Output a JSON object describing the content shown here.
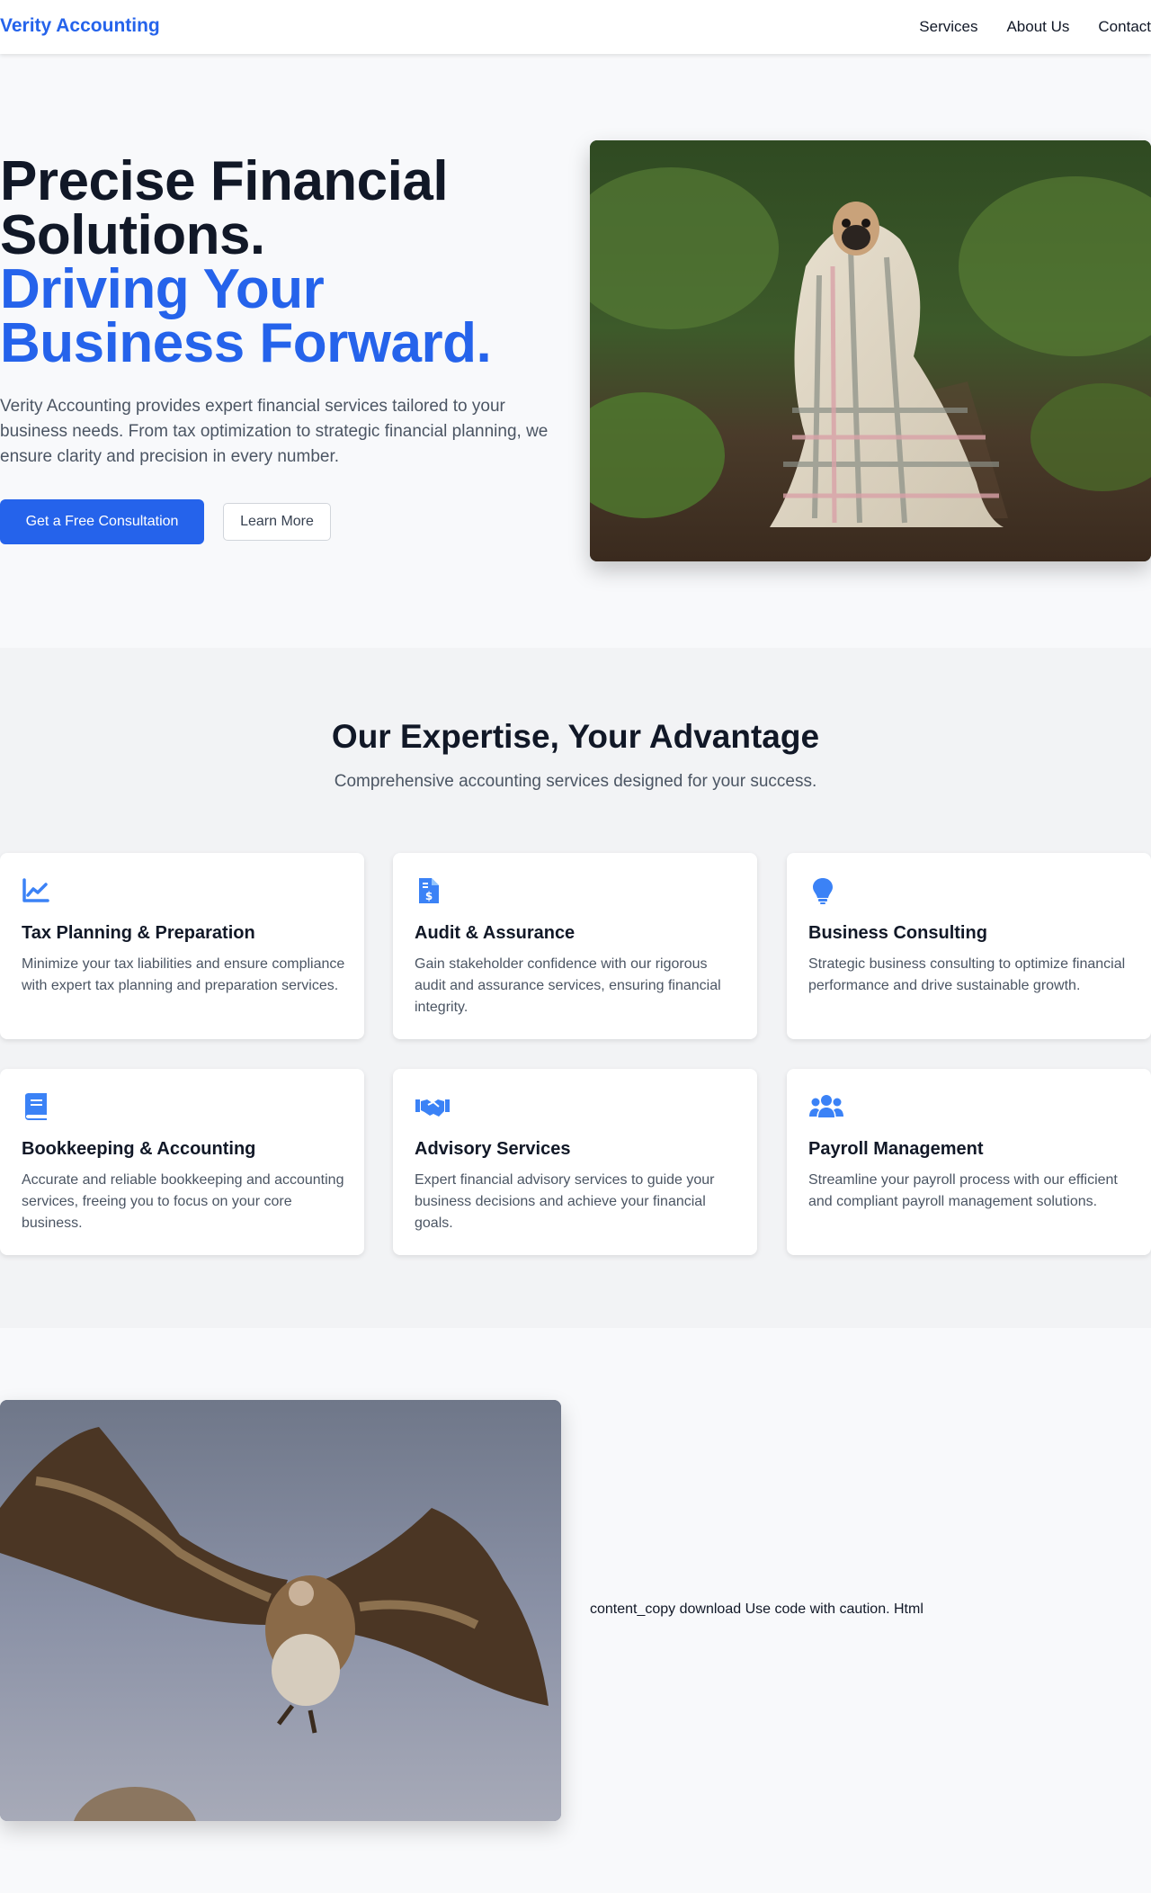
{
  "header": {
    "brand": "Verity Accounting",
    "nav": [
      "Services",
      "About Us",
      "Contact"
    ]
  },
  "hero": {
    "title_line1": "Precise Financial",
    "title_line2": "Solutions.",
    "title_line3": "Driving Your",
    "title_line4": "Business Forward.",
    "description": "Verity Accounting provides expert financial services tailored to your business needs. From tax optimization to strategic financial planning, we ensure clarity and precision in every number.",
    "primary_button": "Get a Free Consultation",
    "secondary_button": "Learn More"
  },
  "services": {
    "title": "Our Expertise, Your Advantage",
    "subtitle": "Comprehensive accounting services designed for your success.",
    "cards": [
      {
        "icon": "chart-line-icon",
        "title": "Tax Planning & Preparation",
        "description": "Minimize your tax liabilities and ensure compliance with expert tax planning and preparation services."
      },
      {
        "icon": "invoice-dollar-icon",
        "title": "Audit & Assurance",
        "description": "Gain stakeholder confidence with our rigorous audit and assurance services, ensuring financial integrity."
      },
      {
        "icon": "lightbulb-icon",
        "title": "Business Consulting",
        "description": "Strategic business consulting to optimize financial performance and drive sustainable growth."
      },
      {
        "icon": "book-icon",
        "title": "Bookkeeping & Accounting",
        "description": "Accurate and reliable bookkeeping and accounting services, freeing you to focus on your core business."
      },
      {
        "icon": "handshake-icon",
        "title": "Advisory Services",
        "description": "Expert financial advisory services to guide your business decisions and achieve your financial goals."
      },
      {
        "icon": "users-icon",
        "title": "Payroll Management",
        "description": "Streamline your payroll process with our efficient and compliant payroll management solutions."
      }
    ]
  },
  "about": {
    "stray_text": "content_copy download Use code with caution. Html"
  },
  "colors": {
    "accent": "#2563eb",
    "icon": "#3b82f6",
    "text_dark": "#111827",
    "text_muted": "#4b5563"
  }
}
